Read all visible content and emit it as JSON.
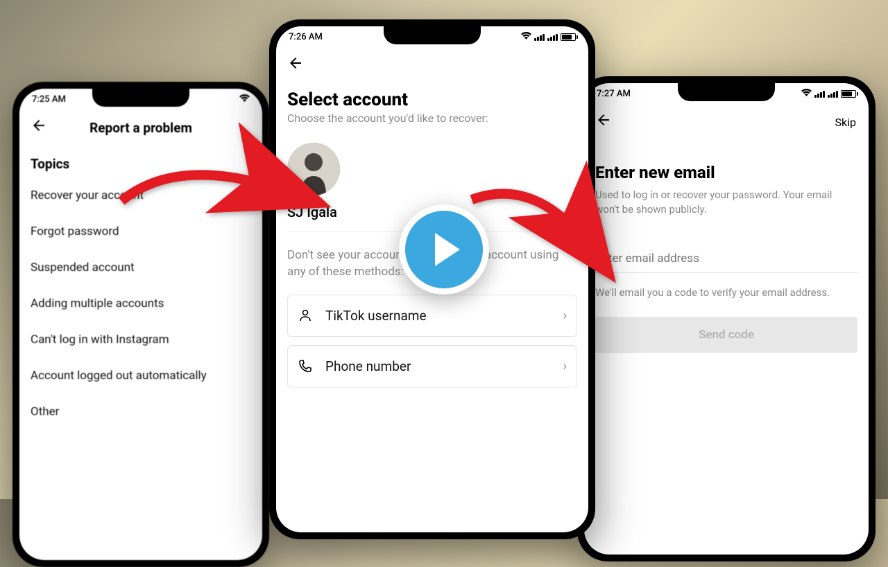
{
  "phone1": {
    "time": "7:25 AM",
    "header_title": "Report a problem",
    "topics_heading": "Topics",
    "topics": [
      "Recover your account",
      "Forgot password",
      "Suspended account",
      "Adding multiple accounts",
      "Can't log in with Instagram",
      "Account logged out automatically",
      "Other"
    ]
  },
  "phone2": {
    "time": "7:26 AM",
    "title": "Select account",
    "subtitle": "Choose the account you'd like to recover:",
    "account_name": "SJ Igala",
    "lookup_text": "Don't see your account? Look up your account using any of these methods:",
    "methods": {
      "username": "TikTok username",
      "phone": "Phone number"
    }
  },
  "phone3": {
    "time": "7:27 AM",
    "skip": "Skip",
    "title": "Enter new email",
    "subtitle": "Used to log in or recover your password. Your email won't be shown publicly.",
    "placeholder": "Enter email address",
    "verify_note": "We'll email you a code to verify your email address.",
    "button": "Send code"
  }
}
